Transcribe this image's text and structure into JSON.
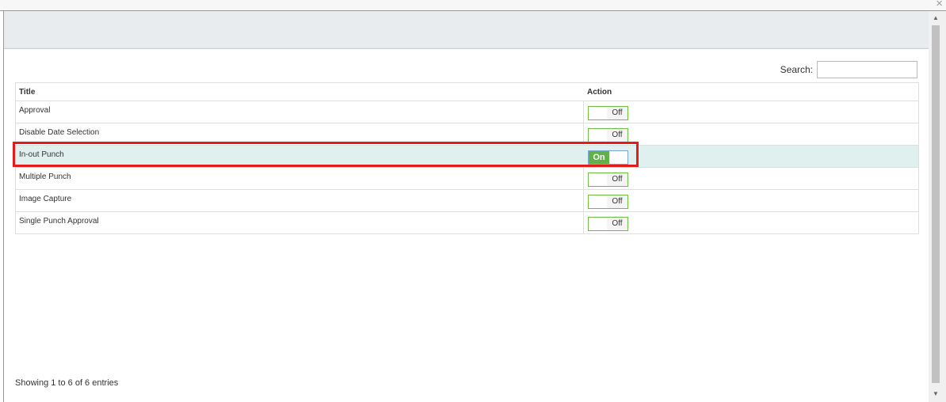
{
  "window": {
    "close_glyph": "×"
  },
  "search": {
    "label": "Search:",
    "value": "",
    "placeholder": ""
  },
  "table": {
    "headers": {
      "title": "Title",
      "action": "Action"
    },
    "rows": [
      {
        "title": "Approval",
        "toggle_label": "Off",
        "state": "off"
      },
      {
        "title": "Disable Date Selection",
        "toggle_label": "Off",
        "state": "off"
      },
      {
        "title": "In-out Punch",
        "toggle_label": "On",
        "state": "on"
      },
      {
        "title": "Multiple Punch",
        "toggle_label": "Off",
        "state": "off"
      },
      {
        "title": "Image Capture",
        "toggle_label": "Off",
        "state": "off"
      },
      {
        "title": "Single Punch Approval",
        "toggle_label": "Off",
        "state": "off"
      }
    ]
  },
  "footer": {
    "info": "Showing 1 to 6 of 6 entries"
  },
  "colors": {
    "toggle_on": "#62b04a",
    "toggle_border": "#6cbe45",
    "highlight_row": "#dff0ee",
    "annotation_box": "#e31b1b"
  }
}
